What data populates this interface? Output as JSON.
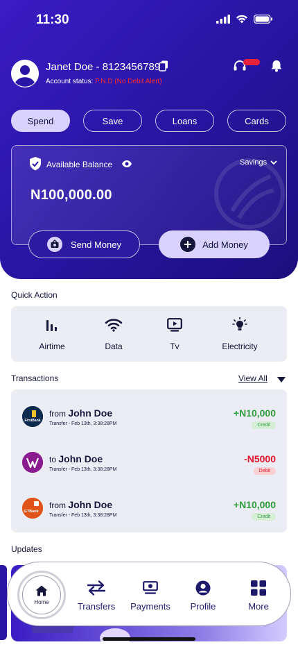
{
  "status_bar": {
    "time": "11:30"
  },
  "header": {
    "user_name": "Janet Doe - 8123456789",
    "account_status_label": "Account status:",
    "account_status_value": "P.N.D (No Debit Alert)"
  },
  "tabs": [
    {
      "label": "Spend",
      "active": true
    },
    {
      "label": "Save",
      "active": false
    },
    {
      "label": "Loans",
      "active": false
    },
    {
      "label": "Cards",
      "active": false
    }
  ],
  "balance": {
    "label": "Available Balance",
    "account_type": "Savings",
    "amount": "N100,000.00"
  },
  "actions": {
    "send_money": "Send Money",
    "add_money": "Add Money"
  },
  "quick_action": {
    "title": "Quick Action",
    "items": [
      {
        "label": "Airtime",
        "icon": "signal-bars-icon"
      },
      {
        "label": "Data",
        "icon": "wifi-icon"
      },
      {
        "label": "Tv",
        "icon": "tv-play-icon"
      },
      {
        "label": "Electricity",
        "icon": "bulb-icon"
      }
    ]
  },
  "transactions": {
    "title": "Transactions",
    "view_all": "View All",
    "items": [
      {
        "direction": "from",
        "name": "John Doe",
        "meta": "Transfer - Feb 13th, 3:38:28PM",
        "amount": "+N10,000",
        "type": "Credit",
        "bank": "FirstBank",
        "logo_color": "#0b2a4d"
      },
      {
        "direction": "to",
        "name": "John Doe",
        "meta": "Transfer - Feb 13th, 3:38:28PM",
        "amount": "-N5000",
        "type": "Debit",
        "bank": "W",
        "logo_color": "#8a1c8f"
      },
      {
        "direction": "from",
        "name": "John Doe",
        "meta": "Transfer - Feb 13th, 3:38:28PM",
        "amount": "+N10,000",
        "type": "Credit",
        "bank": "GTBank",
        "logo_color": "#e0541a"
      }
    ]
  },
  "updates": {
    "title": "Updates"
  },
  "bottom_nav": {
    "home": "Home",
    "items": [
      {
        "label": "Transfers",
        "icon": "transfer-arrows-icon"
      },
      {
        "label": "Payments",
        "icon": "cash-icon"
      },
      {
        "label": "Profile",
        "icon": "profile-icon"
      },
      {
        "label": "More",
        "icon": "grid-icon"
      }
    ]
  },
  "colors": {
    "primary": "#2a16a6",
    "accent_light": "#d9d2ff",
    "credit": "#2f9d3c",
    "debit": "#e0162a",
    "alert": "#ff2a2a"
  }
}
